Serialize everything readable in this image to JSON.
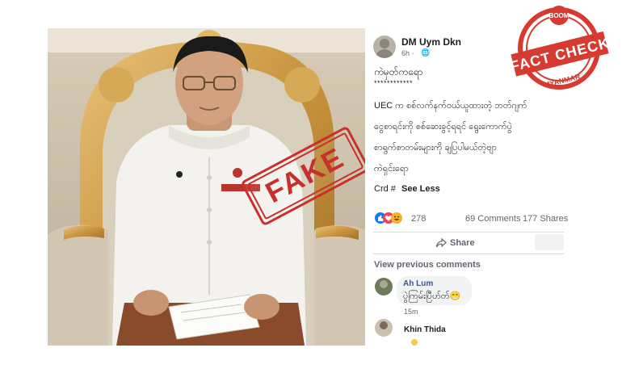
{
  "post": {
    "author": "DM Uym Dkn",
    "time": "6h ·",
    "heading": "ကဲမှတ်ကရော",
    "stars": "************",
    "body_line1": "UEC က စစ်လက်နက်ဝယ်ယူထားတဲ့ ဘတ်ဂျက်",
    "body_line2": "ငွေစာရင်းကို စစ်ဆေးခွင့်ရရင် ရွေးကောက်ပွဲ",
    "body_line3": "စာရွက်စာတမ်းများကို ချပြပါမယ်တဲ့ဗျာ",
    "body_line4": "ကဲရှင်းရော",
    "crd_text": "Crd #",
    "see_less": "See Less",
    "reactions_count": "278",
    "comments_count": "69 Comments",
    "shares_count": "177 Shares",
    "share_label": "Share",
    "view_previous": "View previous comments"
  },
  "comments": [
    {
      "author": "Ah Lum",
      "text": "ပွဲကြမ်းပြီဟ်တ်😁",
      "time": "15m"
    },
    {
      "author": "Khin Thida",
      "text": "",
      "time": ""
    }
  ],
  "stamps": {
    "fake": "FAKE",
    "badge_top": "BOOM",
    "badge_main": "FACT CHECK",
    "badge_bottom": "MYANMAR"
  },
  "colors": {
    "stamp_red": "#c8312b",
    "link_blue": "#385898",
    "like_blue": "#1877f2"
  }
}
